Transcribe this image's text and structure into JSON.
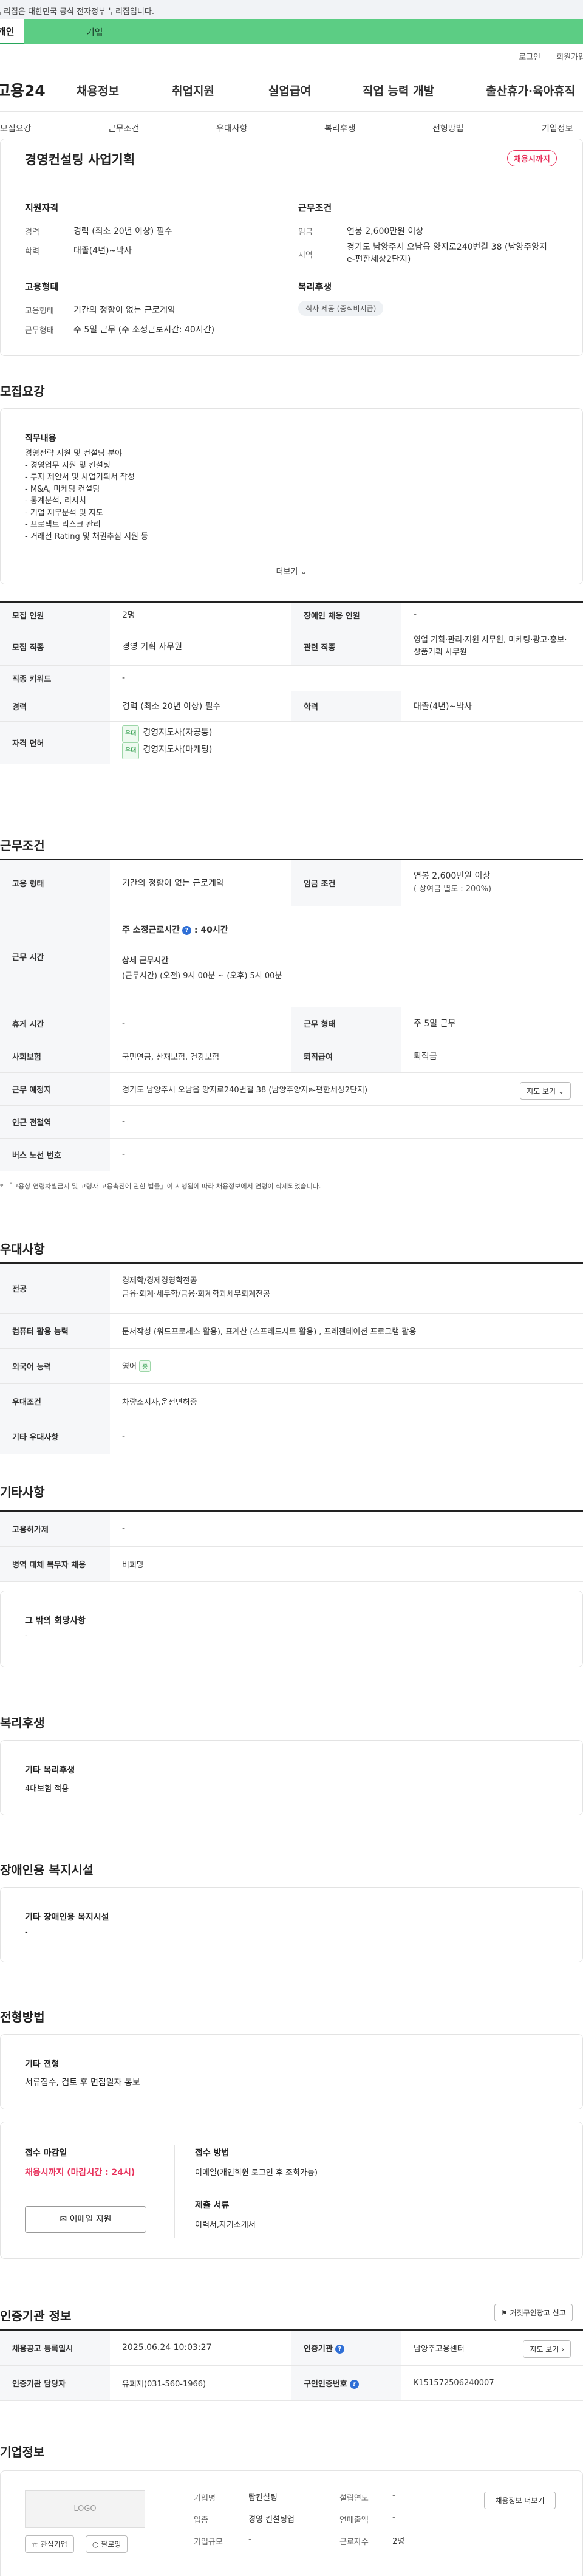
{
  "gov_banner": "이 누리집은 대한민국 공식 전자정부 누리집입니다.",
  "user_tabs": {
    "person": "개인",
    "company": "기업"
  },
  "util": {
    "login": "로그인",
    "join": "회원가입"
  },
  "logo": "고용24",
  "gnb": [
    "채용정보",
    "취업지원",
    "실업급여",
    "직업 능력 개발",
    "출산휴가·육아휴직"
  ],
  "snb": [
    "모집요강",
    "근무조건",
    "우대사항",
    "복리후생",
    "전형방법",
    "기업정보"
  ],
  "summary": {
    "title": "경영컨설팅 사업기획",
    "status_badge": "채용시까지",
    "qual_title": "지원자격",
    "career_label": "경력",
    "career_value": "경력 (최소 20년 이상) 필수",
    "edu_label": "학력",
    "edu_value": "대졸(4년)~박사",
    "cond_title": "근무조건",
    "wage_label": "임금",
    "wage_value": "연봉 2,600만원 이상",
    "loc_label": "지역",
    "loc_value": "경기도 남양주시 오남읍 양지로240번길 38 (남양주양지e-편한세상2단지)",
    "emp_title": "고용형태",
    "emp_type_label": "고용형태",
    "emp_type_value": "기간의 정함이 없는 근로계약",
    "work_form_label": "근무형태",
    "work_form_value": "주 5일 근무 (주 소정근로시간: 40시간)",
    "welfare_title": "복리후생",
    "welfare_tag": "식사 제공 (중식비지급)"
  },
  "recruit": {
    "section_title": "모집요강",
    "duty_title": "직무내용",
    "duty_lines": [
      "경영전략 지원 및 컨설팅 분야",
      "- 경영업무 지원 및 컨설팅",
      "- 투자 제안서 및 사업기획서 작성",
      "- M&A, 마케팅 컨설팅",
      "- 통계분석, 리서치",
      "- 기업 재무분석 및 지도",
      "- 프로젝트 리스크 관리",
      "- 거래선 Rating 및 채권추심 지원 등"
    ],
    "more": "더보기",
    "rows": {
      "headcount_label": "모집 인원",
      "headcount_value": "2명",
      "disabled_label": "장애인 채용 인원",
      "disabled_value": "-",
      "job_label": "모집 직종",
      "job_value": "경영 기획 사무원",
      "related_label": "관련 직종",
      "related_value": "영업 기획·관리·지원 사무원, 마케팅·광고·홍보·상품기획 사무원",
      "keyword_label": "직종 키워드",
      "keyword_value": "-",
      "career_label": "경력",
      "career_value": "경력 (최소 20년 이상) 필수",
      "edu_label": "학력",
      "edu_value": "대졸(4년)~박사",
      "license_label": "자격 면허",
      "license_tag": "우대",
      "licenses": [
        "경영지도사(자공통)",
        "경영지도사(마케팅)"
      ]
    }
  },
  "conditions": {
    "section_title": "근무조건",
    "emp_label": "고용 형태",
    "emp_value": "기간의 정함이 없는 근로계약",
    "wage_label": "임금 조건",
    "wage_value": "연봉 2,600만원 이상",
    "wage_note": "( 상여금 별도 : 200%)",
    "time_label": "근무 시간",
    "weekly_hours": "주 소정근로시간",
    "weekly_hours_value": "40시간",
    "detail_title": "상세 근무시간",
    "detail_value": "(근무시간) (오전) 9시 00분 ~ (오후) 5시 00분",
    "rest_label": "휴게 시간",
    "rest_value": "-",
    "work_form_label": "근무 형태",
    "work_form_value": "주 5일 근무",
    "insurance_label": "사회보험",
    "insurance_value": "국민연금, 산재보험, 건강보험",
    "retire_label": "퇴직급여",
    "retire_value": "퇴직금",
    "place_label": "근무 예정지",
    "place_value": "경기도 남양주시 오남읍 양지로240번길 38 (남양주양지e-편한세상2단지)",
    "map_button": "지도 보기",
    "station_label": "인근 전철역",
    "station_value": "-",
    "bus_label": "버스 노선 번호",
    "bus_value": "-",
    "notice": "「고용상 연령차별금지 및 고령자 고용촉진에 관한 법률」이 시행됨에 따라 채용정보에서 연령이 삭제되었습니다."
  },
  "preference": {
    "section_title": "우대사항",
    "major_label": "전공",
    "major_lines": [
      "경제학/경제경영학전공",
      "금융·회계·세무학/금융·회계학과세무회계전공"
    ],
    "computer_label": "컴퓨터 활용 능력",
    "computer_value": "문서작성 (워드프로세스 활용), 표계산 (스프레드시트 활용) , 프레젠테이션 프로그램 활용",
    "lang_label": "외국어 능력",
    "lang_value": "영어",
    "lang_badge": "중",
    "cond_label": "우대조건",
    "cond_value": "차량소지자,운전면허증",
    "etc_label": "기타 우대사항",
    "etc_value": "-"
  },
  "etc": {
    "section_title": "기타사항",
    "insurance_label": "고용허가제",
    "insurance_value": "-",
    "military_label": "병역 대체 복무자 채용",
    "military_value": "비희망",
    "wish_title": "그 밖의 희망사항",
    "wish_value": "-"
  },
  "welfare": {
    "section_title": "복리후생",
    "etc_title": "기타 복리후생",
    "etc_value": "4대보험 적용"
  },
  "disabled": {
    "section_title": "장애인용 복지시설",
    "etc_title": "기타 장애인용 복지시설",
    "etc_value": "-"
  },
  "selection": {
    "section_title": "전형방법",
    "method_title": "기타 전형",
    "method_value": "서류접수, 검토 후 면접일자 통보",
    "deadline_label": "접수 마감일",
    "deadline_value": "채용시까지 (마감시간 : 24시)",
    "email_button": "이메일 지원",
    "apply_label": "접수 방법",
    "apply_value": "이메일(개인회원 로그인 후 조회가능)",
    "docs_label": "제출 서류",
    "docs_value": "이력서,자기소개서"
  },
  "cert_info": {
    "section_title": "인증기관 정보",
    "report_button": "거짓구인광고 신고",
    "reg_label": "채용공고 등록일시",
    "reg_value": "2025.06.24 10:03:27",
    "org_label": "인증기관",
    "org_value": "남양주고용센터",
    "map_button": "지도 보기",
    "manager_label": "인증기관 담당자",
    "manager_value": "유희재(031-560-1966)",
    "number_label": "구인인증번호",
    "number_value": "K151572506240007"
  },
  "company": {
    "section_title": "기업정보",
    "logo_placeholder": "LOGO",
    "interest_button": "관심기업",
    "follow_button": "팔로잉",
    "name_label": "기업명",
    "name_value": "탑컨설팅",
    "founded_label": "설립연도",
    "founded_value": "-",
    "industry_label": "업종",
    "industry_value": "경영 컨설팅업",
    "sales_label": "연매출액",
    "sales_value": "-",
    "size_label": "기업규모",
    "size_value": "-",
    "staff_label": "근로자수",
    "staff_value": "2명",
    "jobs_button": "채용정보 더보기"
  },
  "colors": {
    "accent_green": "#5ccd84",
    "badge_red": "#e8325c",
    "link_blue": "#2f6fd6"
  }
}
